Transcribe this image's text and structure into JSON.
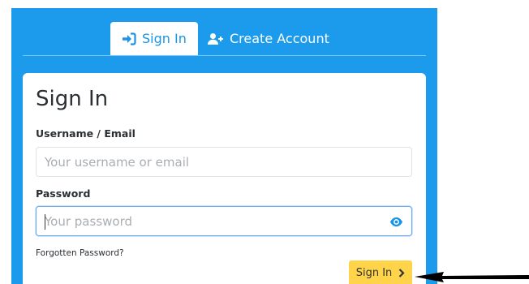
{
  "tabs": {
    "signin_label": "Sign In",
    "create_label": "Create Account"
  },
  "card": {
    "title": "Sign In"
  },
  "username": {
    "label": "Username / Email",
    "placeholder": "Your username or email",
    "value": ""
  },
  "password": {
    "label": "Password",
    "placeholder": "Your password",
    "value": ""
  },
  "links": {
    "forgot": "Forgotten Password?"
  },
  "actions": {
    "signin_label": "Sign In"
  },
  "icons": {
    "signin_tab": "sign-in-icon",
    "create_tab": "user-plus-icon",
    "password_toggle": "eye-icon",
    "signin_button": "chevron-right-icon",
    "annotation": "arrow-left-icon"
  },
  "colors": {
    "panel": "#1c9bec",
    "accent": "#1b94e6",
    "button": "#ffd34a",
    "focus_border": "#6aaaf0"
  }
}
